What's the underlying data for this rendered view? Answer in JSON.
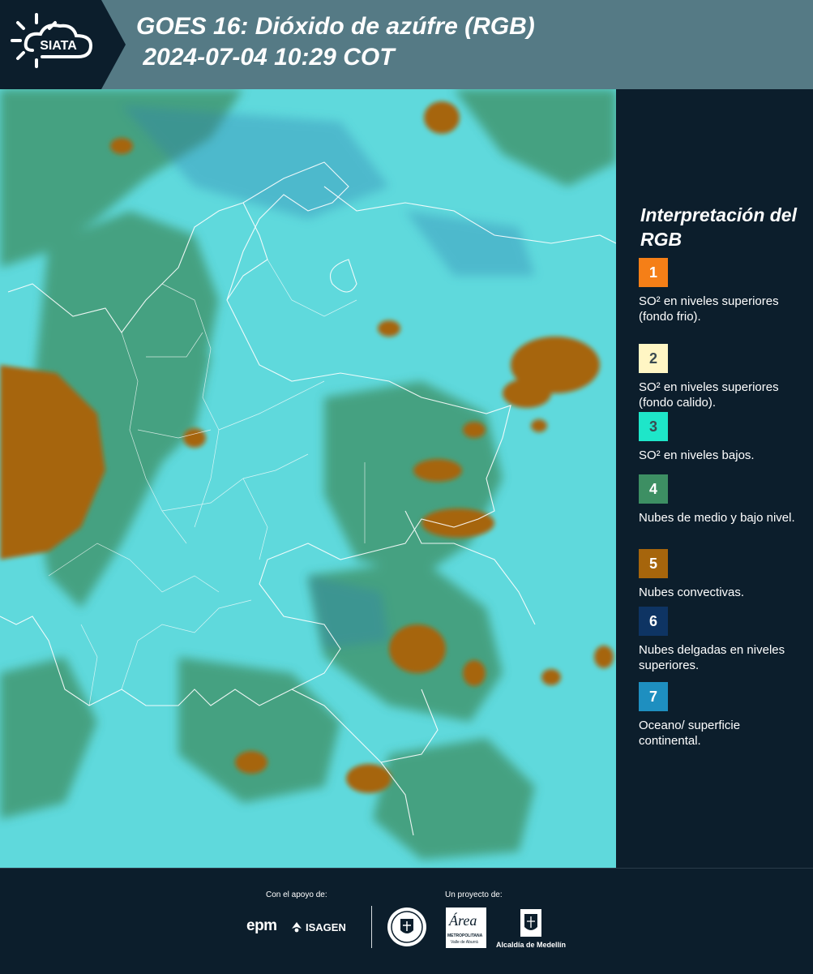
{
  "header": {
    "logo_text": "SIATA",
    "title_line1": "GOES 16: Dióxido de azúfre (RGB)",
    "title_line2": " 2024-07-04 10:29 COT"
  },
  "legend": {
    "title": "Interpretación del RGB",
    "items": [
      {
        "number": "1",
        "color": "#f57f17",
        "text": "SO² en niveles superiores (fondo frio)."
      },
      {
        "number": "2",
        "color": "#fff6c4",
        "text": "SO² en niveles superiores (fondo calido)."
      },
      {
        "number": "3",
        "color": "#1ee6c9",
        "text": "SO² en niveles bajos."
      },
      {
        "number": "4",
        "color": "#3d8f63",
        "text": "Nubes de medio y bajo nivel."
      },
      {
        "number": "5",
        "color": "#a6650c",
        "text": "Nubes convectivas."
      },
      {
        "number": "6",
        "color": "#0e3463",
        "text": "Nubes delgadas en niveles superiores."
      },
      {
        "number": "7",
        "color": "#1e8fc0",
        "text": "Oceano/ superficie continental."
      }
    ]
  },
  "footer": {
    "support_label": "Con el apoyo de:",
    "project_label": "Un proyecto de:",
    "sponsor_epm": "epm",
    "sponsor_isagen": "ISAGEN",
    "area_name": "Área",
    "area_line1": "METROPOLITANA",
    "area_line2": "Valle de Aburrá",
    "alcaldia": "Alcaldía de Medellín"
  },
  "colors": {
    "background": "#0c1e2c",
    "header": "#557a85",
    "map_base": "#5fd9dc",
    "vegetation_green": "#3d8f63",
    "convective_brown": "#a6650c"
  }
}
